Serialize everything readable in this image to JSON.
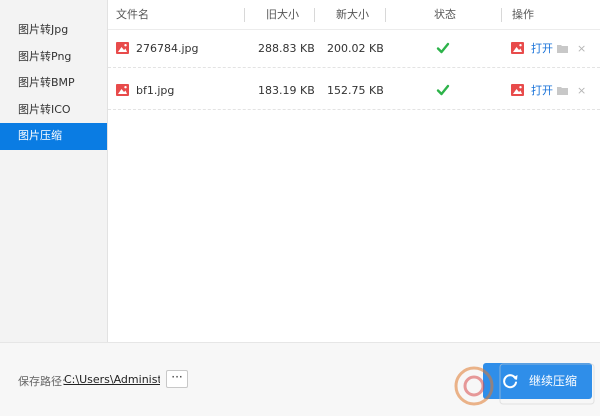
{
  "sidebar": {
    "items": [
      {
        "label": "图片转Jpg"
      },
      {
        "label": "图片转Png"
      },
      {
        "label": "图片转BMP"
      },
      {
        "label": "图片转ICO"
      },
      {
        "label": "图片压缩",
        "active": true
      }
    ]
  },
  "table": {
    "headers": {
      "filename": "文件名",
      "old_size": "旧大小",
      "new_size": "新大小",
      "status": "状态",
      "action": "操作"
    },
    "rows": [
      {
        "filename": "276784.jpg",
        "old_size": "288.83 KB",
        "new_size": "200.02 KB",
        "status": "success",
        "open_label": "打开",
        "close_label": "×"
      },
      {
        "filename": "bf1.jpg",
        "old_size": "183.19 KB",
        "new_size": "152.75 KB",
        "status": "success",
        "open_label": "打开",
        "close_label": "×"
      }
    ]
  },
  "footer": {
    "save_label": "保存路径:",
    "save_path": "C:\\Users\\Administrat",
    "more_label": "···",
    "compress_label": "继续压缩"
  },
  "colors": {
    "accent": "#0a7ce3",
    "button": "#2f8ee9",
    "file_icon": "#e84b4b",
    "check": "#2db34a",
    "link": "#1a73d9"
  },
  "icons": {
    "file": "image-file-icon",
    "status": "check-icon",
    "action_image": "image-icon",
    "folder": "folder-icon",
    "close": "close-icon",
    "compress": "refresh-icon"
  }
}
